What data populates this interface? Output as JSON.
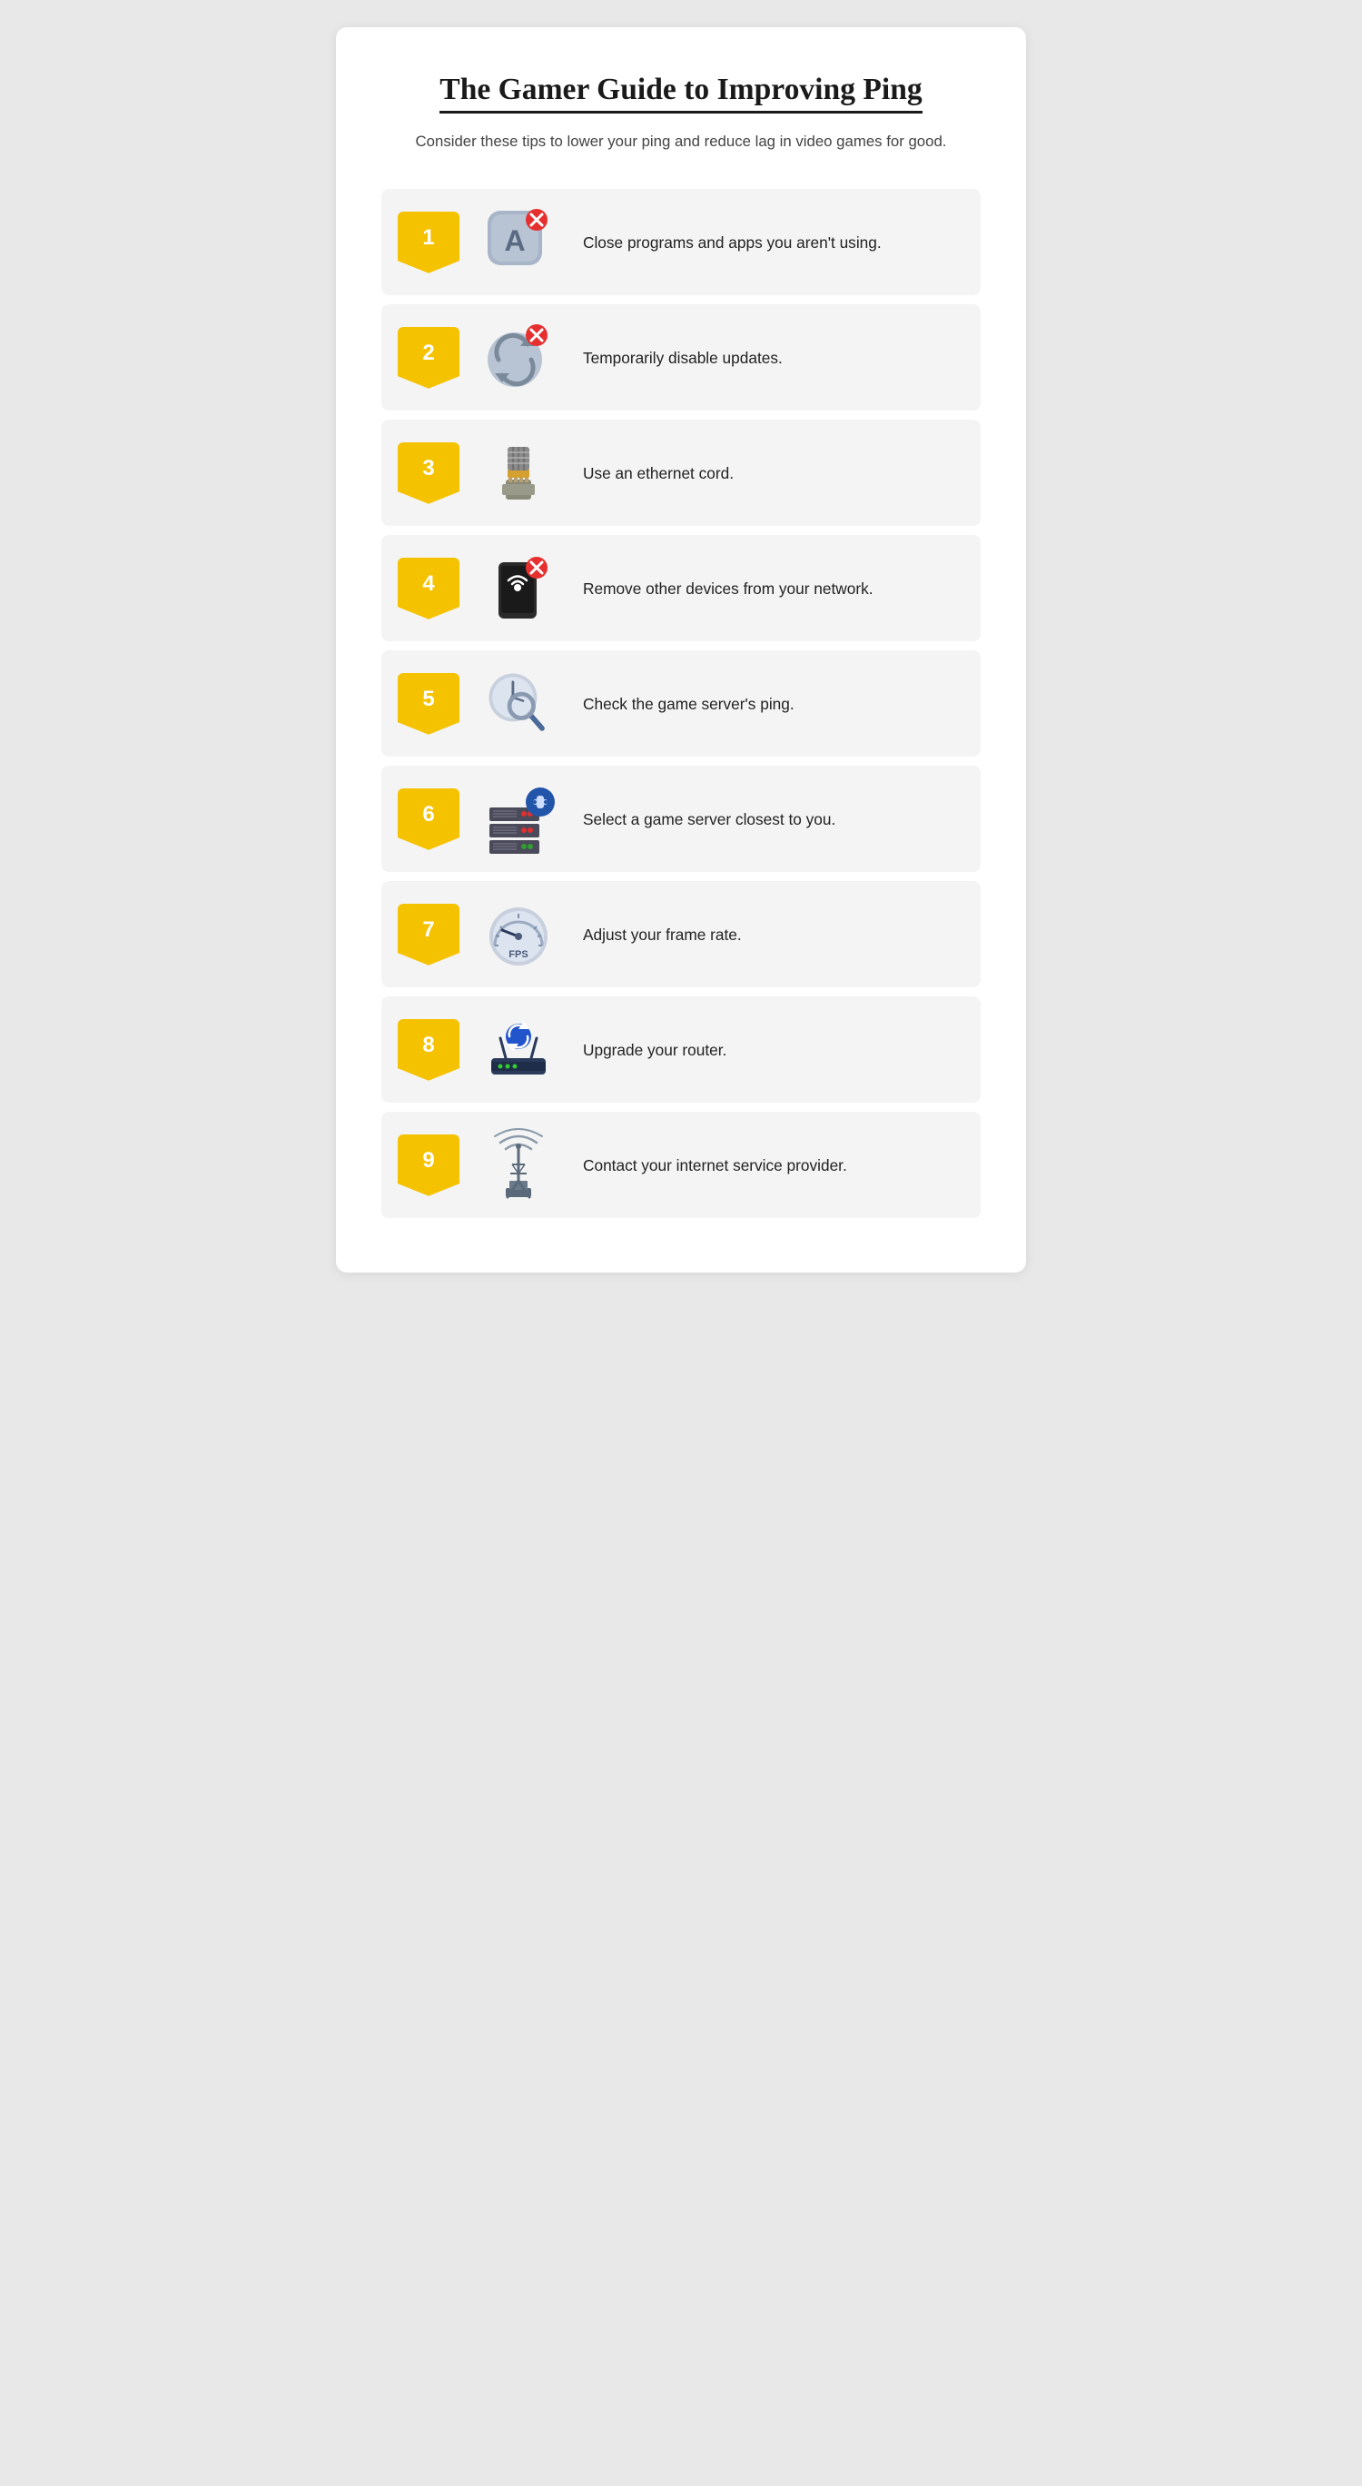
{
  "header": {
    "title": "The Gamer Guide to Improving Ping",
    "subtitle": "Consider these tips to lower your ping and reduce lag in video games for good."
  },
  "tips": [
    {
      "number": "1",
      "text": "Close programs and apps you aren't using.",
      "icon": "app-close"
    },
    {
      "number": "2",
      "text": "Temporarily disable updates.",
      "icon": "update-disable"
    },
    {
      "number": "3",
      "text": "Use an ethernet cord.",
      "icon": "ethernet"
    },
    {
      "number": "4",
      "text": "Remove other devices from your network.",
      "icon": "remove-devices"
    },
    {
      "number": "5",
      "text": "Check the game server's ping.",
      "icon": "ping-check"
    },
    {
      "number": "6",
      "text": "Select a game server closest to you.",
      "icon": "game-server"
    },
    {
      "number": "7",
      "text": "Adjust your frame rate.",
      "icon": "fps-meter"
    },
    {
      "number": "8",
      "text": "Upgrade your router.",
      "icon": "router"
    },
    {
      "number": "9",
      "text": "Contact your internet service provider.",
      "icon": "isp-tower"
    }
  ]
}
